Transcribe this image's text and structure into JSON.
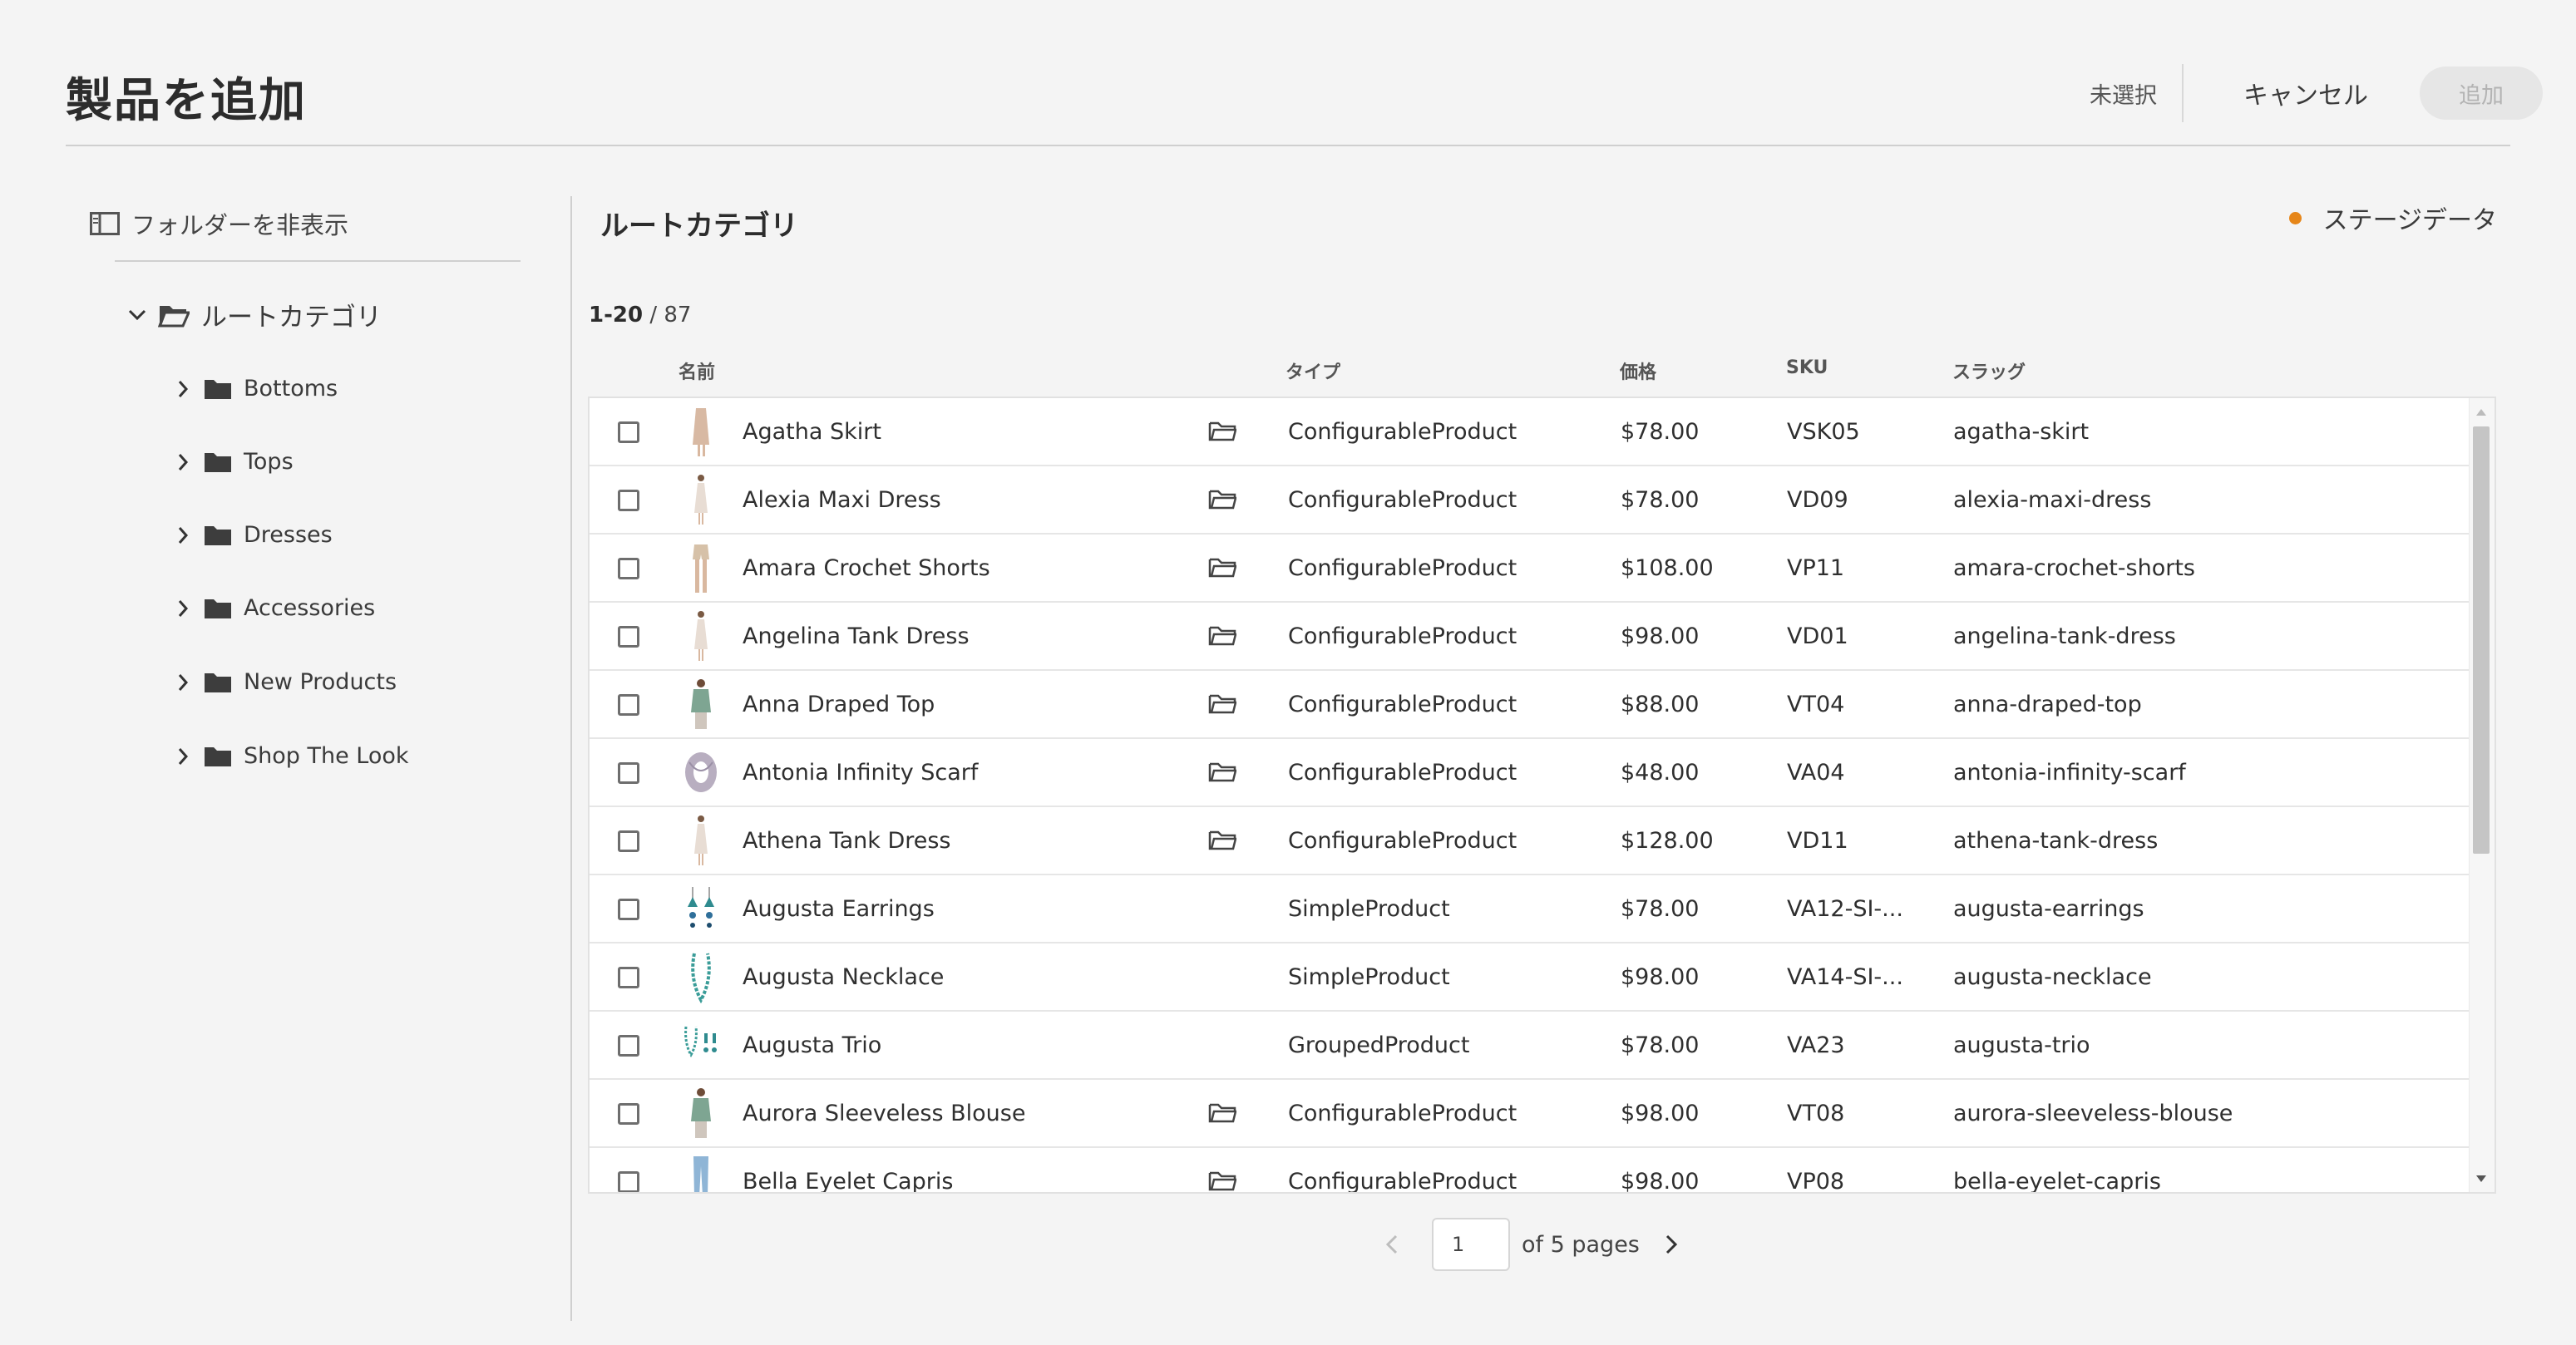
{
  "header": {
    "title": "製品を追加",
    "selection_status": "未選択",
    "cancel_label": "キャンセル",
    "add_label": "追加"
  },
  "sidebar": {
    "toggle_label": "フォルダーを非表示",
    "root_label": "ルートカテゴリ",
    "items": [
      {
        "label": "Bottoms"
      },
      {
        "label": "Tops"
      },
      {
        "label": "Dresses"
      },
      {
        "label": "Accessories"
      },
      {
        "label": "New Products"
      },
      {
        "label": "Shop The Look"
      }
    ]
  },
  "main": {
    "title": "ルートカテゴリ",
    "stage_label": "ステージデータ",
    "stage_color": "#e68619",
    "count_range": "1-20",
    "count_total": " / 87",
    "columns": {
      "name": "名前",
      "type": "タイプ",
      "price": "価格",
      "sku": "SKU",
      "slug": "スラッグ"
    },
    "rows": [
      {
        "name": "Agatha Skirt",
        "type": "ConfigurableProduct",
        "price": "$78.00",
        "sku": "VSK05",
        "slug": "agatha-skirt",
        "has_folder": true,
        "thumb": "skirt"
      },
      {
        "name": "Alexia Maxi Dress",
        "type": "ConfigurableProduct",
        "price": "$78.00",
        "sku": "VD09",
        "slug": "alexia-maxi-dress",
        "has_folder": true,
        "thumb": "dress"
      },
      {
        "name": "Amara Crochet Shorts",
        "type": "ConfigurableProduct",
        "price": "$108.00",
        "sku": "VP11",
        "slug": "amara-crochet-shorts",
        "has_folder": true,
        "thumb": "shorts"
      },
      {
        "name": "Angelina Tank Dress",
        "type": "ConfigurableProduct",
        "price": "$98.00",
        "sku": "VD01",
        "slug": "angelina-tank-dress",
        "has_folder": true,
        "thumb": "dress"
      },
      {
        "name": "Anna Draped Top",
        "type": "ConfigurableProduct",
        "price": "$88.00",
        "sku": "VT04",
        "slug": "anna-draped-top",
        "has_folder": true,
        "thumb": "top"
      },
      {
        "name": "Antonia Infinity Scarf",
        "type": "ConfigurableProduct",
        "price": "$48.00",
        "sku": "VA04",
        "slug": "antonia-infinity-scarf",
        "has_folder": true,
        "thumb": "scarf"
      },
      {
        "name": "Athena Tank Dress",
        "type": "ConfigurableProduct",
        "price": "$128.00",
        "sku": "VD11",
        "slug": "athena-tank-dress",
        "has_folder": true,
        "thumb": "dress"
      },
      {
        "name": "Augusta Earrings",
        "type": "SimpleProduct",
        "price": "$78.00",
        "sku": "VA12-SI-...",
        "slug": "augusta-earrings",
        "has_folder": false,
        "thumb": "earrings"
      },
      {
        "name": "Augusta Necklace",
        "type": "SimpleProduct",
        "price": "$98.00",
        "sku": "VA14-SI-...",
        "slug": "augusta-necklace",
        "has_folder": false,
        "thumb": "necklace"
      },
      {
        "name": "Augusta Trio",
        "type": "GroupedProduct",
        "price": "$78.00",
        "sku": "VA23",
        "slug": "augusta-trio",
        "has_folder": false,
        "thumb": "trio"
      },
      {
        "name": "Aurora Sleeveless Blouse",
        "type": "ConfigurableProduct",
        "price": "$98.00",
        "sku": "VT08",
        "slug": "aurora-sleeveless-blouse",
        "has_folder": true,
        "thumb": "top"
      },
      {
        "name": "Bella Eyelet Capris",
        "type": "ConfigurableProduct",
        "price": "$98.00",
        "sku": "VP08",
        "slug": "bella-eyelet-capris",
        "has_folder": true,
        "thumb": "pants"
      }
    ]
  },
  "pagination": {
    "current_page": "1",
    "of_pages_label": "of 5 pages"
  }
}
